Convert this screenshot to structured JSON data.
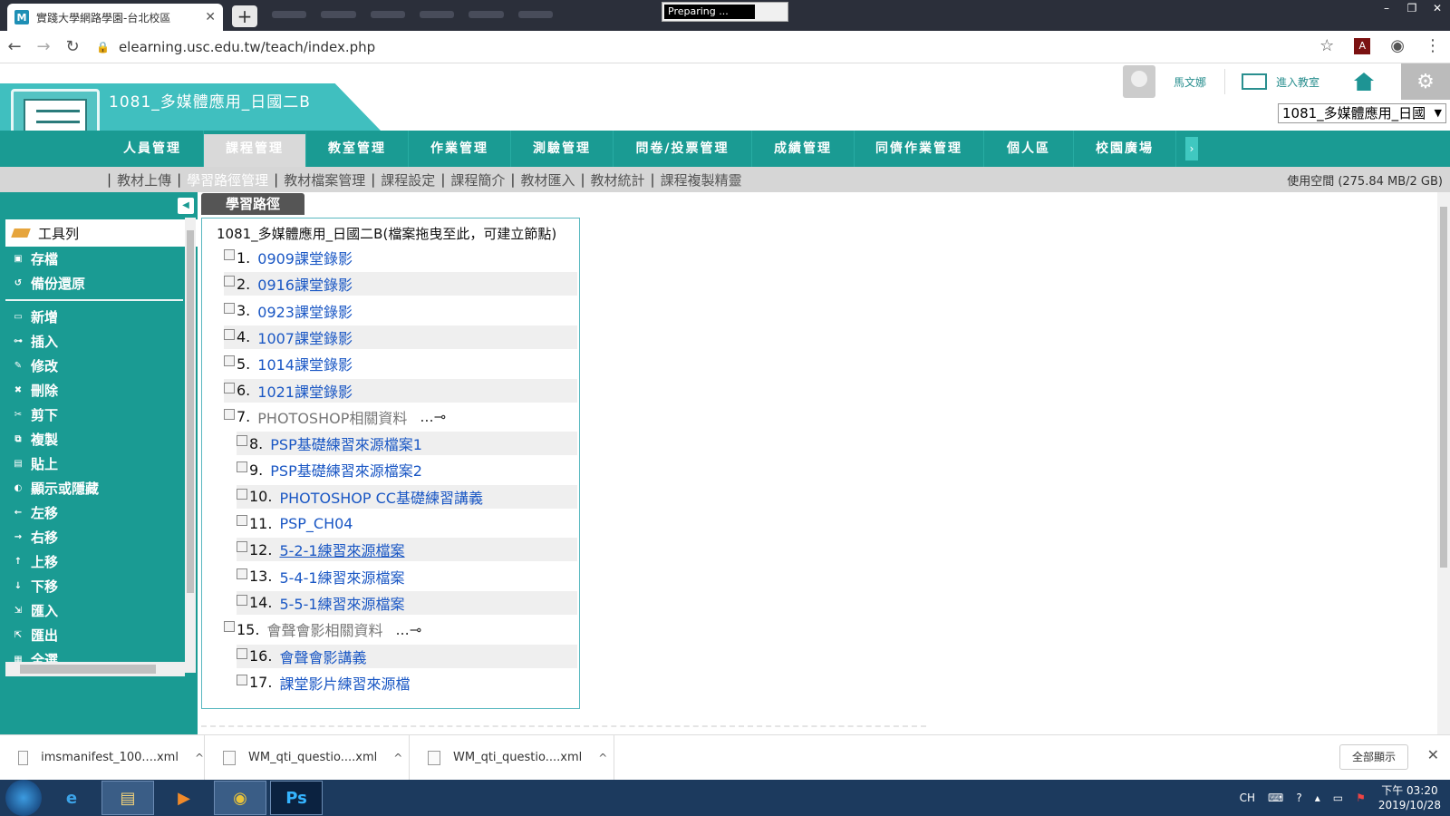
{
  "browser": {
    "tab_title": "實踐大學網路學園-台北校區",
    "tab_favicon": "M",
    "tab_close": "✕",
    "new_tab": "+",
    "preparing": "Preparing ...",
    "url": "elearning.usc.edu.tw/teach/index.php",
    "window_controls": [
      "–",
      "❐",
      "✕"
    ]
  },
  "header": {
    "course_title": "1081_多媒體應用_日國二B",
    "user_name": "馬文娜",
    "classroom_label": "進入教室",
    "course_select": "1081_多媒體應用_日國",
    "course_select_arrow": "▼"
  },
  "main_nav": {
    "items": [
      "人員管理",
      "課程管理",
      "教室管理",
      "作業管理",
      "測驗管理",
      "問卷/投票管理",
      "成績管理",
      "同儕作業管理",
      "個人區",
      "校園廣場"
    ],
    "active_index": 1,
    "more": "›"
  },
  "sub_nav": {
    "items": [
      "教材上傳",
      "學習路徑管理",
      "教材檔案管理",
      "課程設定",
      "課程簡介",
      "教材匯入",
      "教材統計",
      "課程複製精靈"
    ],
    "active_index": 1,
    "separator": "|",
    "quota": "使用空間 (275.84 MB/2 GB)"
  },
  "sidebar": {
    "collapse": "◀",
    "toolbox_title": "工具列",
    "group1": [
      {
        "label": "存檔",
        "icon": "save-icon"
      },
      {
        "label": "備份還原",
        "icon": "restore-icon"
      }
    ],
    "group2": [
      {
        "label": "新增",
        "icon": "folder-icon"
      },
      {
        "label": "插入",
        "icon": "insert-icon"
      },
      {
        "label": "修改",
        "icon": "edit-icon"
      },
      {
        "label": "刪除",
        "icon": "delete-icon"
      },
      {
        "label": "剪下",
        "icon": "cut-icon"
      },
      {
        "label": "複製",
        "icon": "copy-icon"
      },
      {
        "label": "貼上",
        "icon": "paste-icon"
      },
      {
        "label": "顯示或隱藏",
        "icon": "toggle-visibility-icon"
      },
      {
        "label": "左移",
        "icon": "arrow-left-icon"
      },
      {
        "label": "右移",
        "icon": "arrow-right-icon"
      },
      {
        "label": "上移",
        "icon": "arrow-up-icon"
      },
      {
        "label": "下移",
        "icon": "arrow-down-icon"
      },
      {
        "label": "匯入",
        "icon": "import-icon"
      },
      {
        "label": "匯出",
        "icon": "export-icon"
      },
      {
        "label": "全選",
        "icon": "select-all-icon"
      }
    ]
  },
  "content": {
    "tab_label": "學習路徑",
    "root_title": "1081_多媒體應用_日國二B(檔案拖曳至此，可建立節點)",
    "nodes": [
      {
        "num": "1.",
        "label": "0909課堂錄影",
        "type": "link",
        "indent": 0
      },
      {
        "num": "2.",
        "label": "0916課堂錄影",
        "type": "link",
        "indent": 0
      },
      {
        "num": "3.",
        "label": "0923課堂錄影",
        "type": "link",
        "indent": 0
      },
      {
        "num": "4.",
        "label": "1007課堂錄影",
        "type": "link",
        "indent": 0
      },
      {
        "num": "5.",
        "label": "1014課堂錄影",
        "type": "link",
        "indent": 0
      },
      {
        "num": "6.",
        "label": "1021課堂錄影",
        "type": "link",
        "indent": 0
      },
      {
        "num": "7.",
        "label": "PHOTOSHOP相關資料",
        "type": "folder",
        "indent": 0,
        "dots": "...⊸"
      },
      {
        "num": "8.",
        "label": "PSP基礎練習來源檔案1",
        "type": "link",
        "indent": 1
      },
      {
        "num": "9.",
        "label": "PSP基礎練習來源檔案2",
        "type": "link",
        "indent": 1
      },
      {
        "num": "10.",
        "label": "PHOTOSHOP CC基礎練習講義",
        "type": "link",
        "indent": 1
      },
      {
        "num": "11.",
        "label": "PSP_CH04",
        "type": "link",
        "indent": 1
      },
      {
        "num": "12.",
        "label": "5-2-1練習來源檔案",
        "type": "link",
        "indent": 1,
        "hover": true
      },
      {
        "num": "13.",
        "label": "5-4-1練習來源檔案",
        "type": "link",
        "indent": 1
      },
      {
        "num": "14.",
        "label": "5-5-1練習來源檔案",
        "type": "link",
        "indent": 1
      },
      {
        "num": "15.",
        "label": "會聲會影相關資料",
        "type": "folder",
        "indent": 0,
        "dots": "...⊸"
      },
      {
        "num": "16.",
        "label": "會聲會影講義",
        "type": "link",
        "indent": 1
      },
      {
        "num": "17.",
        "label": "課堂影片練習來源檔",
        "type": "link",
        "indent": 1
      }
    ]
  },
  "downloads": {
    "items": [
      "imsmanifest_100....xml",
      "WM_qti_questio....xml",
      "WM_qti_questio....xml"
    ],
    "caret": "^",
    "show_all": "全部顯示",
    "close": "✕"
  },
  "taskbar": {
    "apps": [
      "e",
      "▤",
      "▶",
      "◉",
      "Ps"
    ],
    "lang": "CH",
    "time": "下午 03:20",
    "date": "2019/10/28"
  },
  "colors": {
    "teal": "#1a9b93",
    "link": "#1a57c4"
  }
}
